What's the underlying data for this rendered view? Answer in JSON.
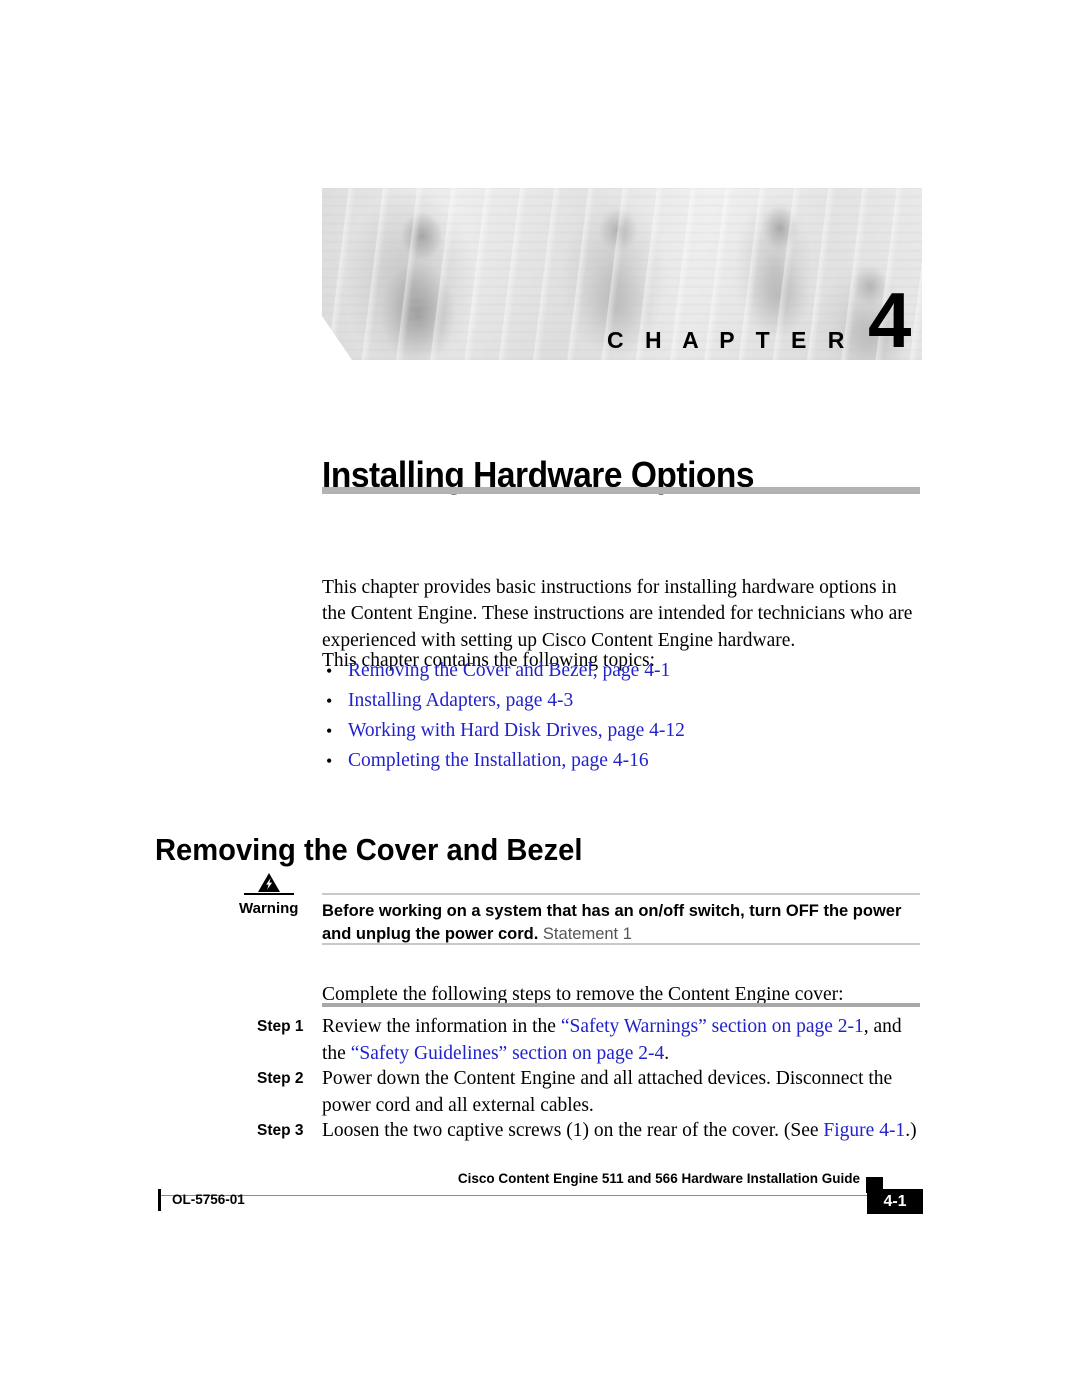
{
  "document": {
    "chapter_word": "C H A P T E R",
    "chapter_number": "4",
    "chapter_title": "Installing Hardware Options"
  },
  "intro": {
    "paragraph_1": "This chapter provides basic instructions for installing hardware options in the Content Engine. These instructions are intended for technicians who are experienced with setting up Cisco Content Engine hardware.",
    "paragraph_2": "This chapter contains the following topics:",
    "bullet": "•"
  },
  "topics": [
    {
      "label": "Removing the Cover and Bezel, page 4-1"
    },
    {
      "label": "Installing Adapters, page 4-3"
    },
    {
      "label": "Working with Hard Disk Drives, page 4-12"
    },
    {
      "label": "Completing the Installation, page 4-16"
    }
  ],
  "section": {
    "heading": "Removing the Cover and Bezel"
  },
  "warning": {
    "label": "Warning",
    "icon": "warning-triangle-lightning-icon",
    "bold_text": "Before working on a system that has an on/off switch, turn OFF the power and unplug the power cord.",
    "statement": " Statement 1"
  },
  "steps_intro": "Complete the following steps to remove the Content Engine cover:",
  "steps": [
    {
      "label": "Step 1",
      "parts": [
        {
          "text": "Review the information in the ",
          "link": false
        },
        {
          "text": "“Safety Warnings” section on page 2-1",
          "link": true
        },
        {
          "text": ", and the ",
          "link": false
        },
        {
          "text": "“Safety Guidelines” section on page 2-4",
          "link": true
        },
        {
          "text": ".",
          "link": false
        }
      ]
    },
    {
      "label": "Step 2",
      "parts": [
        {
          "text": "Power down the Content Engine and all attached devices. Disconnect the power cord and all external cables.",
          "link": false
        }
      ]
    },
    {
      "label": "Step 3",
      "parts": [
        {
          "text": "Loosen the two captive screws (1) on the rear of the cover. (See ",
          "link": false
        },
        {
          "text": "Figure 4-1",
          "link": true
        },
        {
          "text": ".)",
          "link": false
        }
      ]
    }
  ],
  "footer": {
    "title": "Cisco Content Engine 511 and 566 Hardware Installation Guide",
    "doc_number": "OL-5756-01",
    "page_number": "4-1"
  },
  "colors": {
    "link": "#2222cc",
    "rule_gray": "#b3b3b3",
    "warn_rule": "#c8c8c8",
    "step_rule": "#a8a8a8"
  }
}
